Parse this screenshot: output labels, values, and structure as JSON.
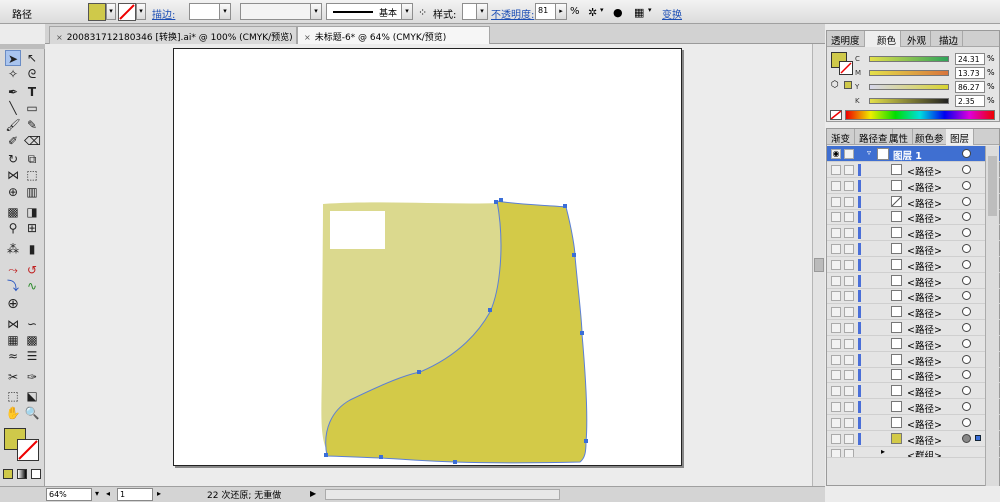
{
  "control_bar": {
    "selection_label": "路径",
    "fill_color": "#cfc94a",
    "stroke_label": "描边:",
    "stroke_style": "基本",
    "style_label": "样式:",
    "opacity_label": "不透明度:",
    "opacity_value": "81",
    "opacity_unit": "%",
    "transform_label": "变换"
  },
  "tabs": [
    {
      "label": "200831712180346 [转换].ai* @ 100% (CMYK/预览)"
    },
    {
      "label": "未标题-6* @ 64% (CMYK/预览)"
    }
  ],
  "status": {
    "zoom": "64%",
    "page": "1",
    "history": "22 次还原; 无重做"
  },
  "color_panel": {
    "tabs": [
      "透明度",
      "颜色",
      "外观",
      "描边"
    ],
    "fill_color": "#cfc94a",
    "channels": [
      {
        "label": "C",
        "value": "24.31"
      },
      {
        "label": "M",
        "value": "13.73"
      },
      {
        "label": "Y",
        "value": "86.27"
      },
      {
        "label": "K",
        "value": "2.35"
      }
    ],
    "unit": "%"
  },
  "layers_panel": {
    "tabs": [
      "渐变",
      "路径查",
      "属性",
      "颜色参",
      "图层"
    ],
    "layer_name": "图层 1",
    "path_label": "<路径>",
    "path_count": 18,
    "partial_label": "<群组>"
  },
  "artwork": {
    "light_shape_color": "#dbd98e",
    "dark_shape_color": "#d3ca48",
    "anchor_color": "#3a6ed8"
  }
}
